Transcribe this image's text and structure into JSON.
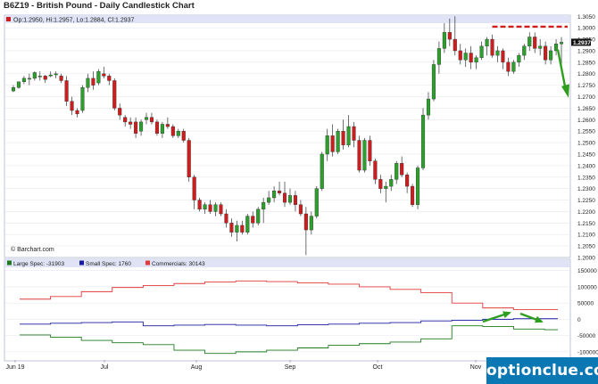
{
  "header": {
    "title": "B6Z19 - British Pound - Daily Candlestick Chart",
    "ohlc": "Op:1.2950, Hi:1.2957, Lo:1.2884, Cl:1.2937",
    "credit": "© Barchart.com"
  },
  "watermark": "optionclue.com",
  "colors": {
    "up": "#2ba12b",
    "down": "#d01c1c",
    "large_spec": "#1f7a1f",
    "small_spec": "#1a1aa0",
    "commercials": "#e03a3a",
    "arrow": "#2f9e1f",
    "resistance": "#d01c1c",
    "header_bg": "#dfe3f5"
  },
  "chart_data": [
    {
      "type": "candlestick",
      "title": "B6Z19 - British Pound - Daily Candlestick Chart",
      "x_ticks": [
        "Jun 19",
        "Jul",
        "Aug",
        "Sep",
        "Oct",
        "Nov"
      ],
      "y_ticks": [
        "1.3050",
        "1.3000",
        "1.2950",
        "1.2900",
        "1.2850",
        "1.2800",
        "1.2750",
        "1.2700",
        "1.2650",
        "1.2600",
        "1.2550",
        "1.2500",
        "1.2450",
        "1.2400",
        "1.2350",
        "1.2300",
        "1.2250",
        "1.2200",
        "1.2150",
        "1.2100",
        "1.2050",
        "1.2000"
      ],
      "ylim": [
        1.2,
        1.3055
      ],
      "last_price": "1.2937",
      "ohlc_points": [
        [
          0,
          1.2725,
          1.275,
          1.272,
          1.274
        ],
        [
          1,
          1.274,
          1.2765,
          1.2735,
          1.2765
        ],
        [
          2,
          1.2765,
          1.279,
          1.2755,
          1.278
        ],
        [
          3,
          1.278,
          1.28,
          1.275,
          1.278
        ],
        [
          4,
          1.278,
          1.281,
          1.277,
          1.2805
        ],
        [
          5,
          1.279,
          1.281,
          1.277,
          1.279
        ],
        [
          6,
          1.279,
          1.2795,
          1.276,
          1.2775
        ],
        [
          7,
          1.279,
          1.281,
          1.2785,
          1.2795
        ],
        [
          8,
          1.2795,
          1.281,
          1.278,
          1.28
        ],
        [
          9,
          1.279,
          1.28,
          1.276,
          1.277
        ],
        [
          10,
          1.277,
          1.279,
          1.266,
          1.268
        ],
        [
          11,
          1.268,
          1.27,
          1.262,
          1.264
        ],
        [
          12,
          1.264,
          1.265,
          1.261,
          1.2625
        ],
        [
          13,
          1.264,
          1.275,
          1.263,
          1.274
        ],
        [
          14,
          1.274,
          1.28,
          1.272,
          1.278
        ],
        [
          15,
          1.278,
          1.281,
          1.273,
          1.275
        ],
        [
          16,
          1.276,
          1.282,
          1.275,
          1.281
        ],
        [
          17,
          1.28,
          1.283,
          1.278,
          1.279
        ],
        [
          18,
          1.279,
          1.28,
          1.275,
          1.277
        ],
        [
          19,
          1.277,
          1.278,
          1.264,
          1.265
        ],
        [
          20,
          1.265,
          1.267,
          1.26,
          1.262
        ],
        [
          21,
          1.261,
          1.262,
          1.257,
          1.259
        ],
        [
          22,
          1.259,
          1.261,
          1.256,
          1.258
        ],
        [
          23,
          1.259,
          1.261,
          1.252,
          1.254
        ],
        [
          24,
          1.255,
          1.26,
          1.253,
          1.259
        ],
        [
          25,
          1.26,
          1.263,
          1.258,
          1.261
        ],
        [
          26,
          1.261,
          1.263,
          1.258,
          1.259
        ],
        [
          27,
          1.259,
          1.26,
          1.253,
          1.254
        ],
        [
          28,
          1.254,
          1.259,
          1.252,
          1.258
        ],
        [
          29,
          1.258,
          1.261,
          1.256,
          1.257
        ],
        [
          30,
          1.257,
          1.258,
          1.252,
          1.253
        ],
        [
          31,
          1.253,
          1.256,
          1.252,
          1.255
        ],
        [
          32,
          1.255,
          1.256,
          1.25,
          1.251
        ],
        [
          33,
          1.251,
          1.252,
          1.233,
          1.235
        ],
        [
          34,
          1.235,
          1.236,
          1.221,
          1.225
        ],
        [
          35,
          1.225,
          1.226,
          1.22,
          1.221
        ],
        [
          36,
          1.221,
          1.224,
          1.219,
          1.223
        ],
        [
          37,
          1.223,
          1.225,
          1.219,
          1.22
        ],
        [
          38,
          1.22,
          1.224,
          1.218,
          1.223
        ],
        [
          39,
          1.223,
          1.224,
          1.218,
          1.219
        ],
        [
          40,
          1.219,
          1.221,
          1.213,
          1.215
        ],
        [
          41,
          1.215,
          1.217,
          1.209,
          1.211
        ],
        [
          42,
          1.211,
          1.216,
          1.207,
          1.214
        ],
        [
          43,
          1.214,
          1.216,
          1.21,
          1.211
        ],
        [
          44,
          1.211,
          1.219,
          1.21,
          1.218
        ],
        [
          45,
          1.218,
          1.22,
          1.213,
          1.215
        ],
        [
          46,
          1.215,
          1.222,
          1.214,
          1.221
        ],
        [
          47,
          1.221,
          1.226,
          1.215,
          1.224
        ],
        [
          48,
          1.224,
          1.229,
          1.223,
          1.226
        ],
        [
          49,
          1.226,
          1.231,
          1.224,
          1.229
        ],
        [
          50,
          1.229,
          1.233,
          1.227,
          1.228
        ],
        [
          51,
          1.228,
          1.233,
          1.222,
          1.224
        ],
        [
          52,
          1.224,
          1.23,
          1.223,
          1.227
        ],
        [
          53,
          1.227,
          1.229,
          1.22,
          1.223
        ],
        [
          54,
          1.223,
          1.225,
          1.218,
          1.219
        ],
        [
          55,
          1.219,
          1.222,
          1.201,
          1.212
        ],
        [
          56,
          1.212,
          1.22,
          1.21,
          1.218
        ],
        [
          57,
          1.218,
          1.231,
          1.217,
          1.23
        ],
        [
          58,
          1.23,
          1.246,
          1.229,
          1.245
        ],
        [
          59,
          1.245,
          1.256,
          1.242,
          1.253
        ],
        [
          60,
          1.253,
          1.258,
          1.244,
          1.246
        ],
        [
          61,
          1.246,
          1.256,
          1.245,
          1.255
        ],
        [
          62,
          1.255,
          1.26,
          1.247,
          1.249
        ],
        [
          63,
          1.249,
          1.262,
          1.248,
          1.257
        ],
        [
          64,
          1.257,
          1.259,
          1.248,
          1.251
        ],
        [
          65,
          1.251,
          1.253,
          1.237,
          1.238
        ],
        [
          66,
          1.238,
          1.252,
          1.237,
          1.251
        ],
        [
          67,
          1.251,
          1.253,
          1.24,
          1.242
        ],
        [
          68,
          1.242,
          1.243,
          1.232,
          1.234
        ],
        [
          69,
          1.234,
          1.236,
          1.228,
          1.23
        ],
        [
          70,
          1.23,
          1.233,
          1.224,
          1.231
        ],
        [
          71,
          1.231,
          1.236,
          1.229,
          1.234
        ],
        [
          72,
          1.234,
          1.242,
          1.232,
          1.241
        ],
        [
          73,
          1.241,
          1.244,
          1.235,
          1.236
        ],
        [
          74,
          1.236,
          1.237,
          1.228,
          1.231
        ],
        [
          75,
          1.231,
          1.232,
          1.222,
          1.223
        ],
        [
          76,
          1.223,
          1.24,
          1.221,
          1.239
        ],
        [
          77,
          1.239,
          1.265,
          1.238,
          1.262
        ],
        [
          78,
          1.262,
          1.272,
          1.26,
          1.269
        ],
        [
          79,
          1.269,
          1.286,
          1.268,
          1.284
        ],
        [
          80,
          1.284,
          1.294,
          1.28,
          1.291
        ],
        [
          81,
          1.291,
          1.302,
          1.289,
          1.298
        ],
        [
          82,
          1.298,
          1.304,
          1.292,
          1.295
        ],
        [
          83,
          1.295,
          1.305,
          1.288,
          1.29
        ],
        [
          84,
          1.29,
          1.293,
          1.284,
          1.286
        ],
        [
          85,
          1.286,
          1.291,
          1.283,
          1.289
        ],
        [
          86,
          1.289,
          1.292,
          1.282,
          1.285
        ],
        [
          87,
          1.285,
          1.288,
          1.282,
          1.287
        ],
        [
          88,
          1.287,
          1.294,
          1.286,
          1.292
        ],
        [
          89,
          1.292,
          1.296,
          1.288,
          1.295
        ],
        [
          90,
          1.295,
          1.297,
          1.287,
          1.288
        ],
        [
          91,
          1.288,
          1.292,
          1.285,
          1.29
        ],
        [
          92,
          1.29,
          1.291,
          1.282,
          1.285
        ],
        [
          93,
          1.285,
          1.287,
          1.279,
          1.281
        ],
        [
          94,
          1.281,
          1.286,
          1.28,
          1.285
        ],
        [
          95,
          1.285,
          1.289,
          1.283,
          1.288
        ],
        [
          96,
          1.288,
          1.293,
          1.286,
          1.292
        ],
        [
          97,
          1.292,
          1.298,
          1.29,
          1.296
        ],
        [
          98,
          1.296,
          1.298,
          1.289,
          1.291
        ],
        [
          99,
          1.291,
          1.295,
          1.288,
          1.292
        ],
        [
          100,
          1.292,
          1.294,
          1.284,
          1.286
        ],
        [
          101,
          1.286,
          1.292,
          1.284,
          1.29
        ],
        [
          102,
          1.29,
          1.295,
          1.288,
          1.293
        ],
        [
          103,
          1.293,
          1.296,
          1.284,
          1.2937
        ]
      ],
      "annotations": {
        "resistance_level": 1.3005
      }
    },
    {
      "type": "line",
      "legend": [
        "Large Spec: -31903",
        "Small Spec: 1760",
        "Commercials: 30143"
      ],
      "y_ticks": [
        "150000",
        "100000",
        "50000",
        "0",
        "-50000",
        "-100000"
      ],
      "ylim": [
        -125000,
        160000
      ],
      "series": [
        {
          "name": "Commercials",
          "values": [
            62000,
            70000,
            85000,
            98000,
            104000,
            110000,
            115000,
            118000,
            116000,
            112000,
            108000,
            100000,
            92000,
            82000,
            50000,
            35000,
            30000,
            30000
          ]
        },
        {
          "name": "Small Spec",
          "values": [
            -15000,
            -12000,
            -10000,
            -8000,
            -20000,
            -18000,
            -16000,
            -18000,
            -20000,
            -17000,
            -15000,
            -12000,
            -10000,
            -5000,
            -3000,
            0,
            1760,
            1760
          ]
        },
        {
          "name": "Large Spec",
          "values": [
            -48000,
            -55000,
            -65000,
            -72000,
            -78000,
            -95000,
            -105000,
            -100000,
            -95000,
            -88000,
            -80000,
            -75000,
            -70000,
            -60000,
            -20000,
            -22000,
            -30000,
            -31903
          ]
        }
      ]
    }
  ]
}
